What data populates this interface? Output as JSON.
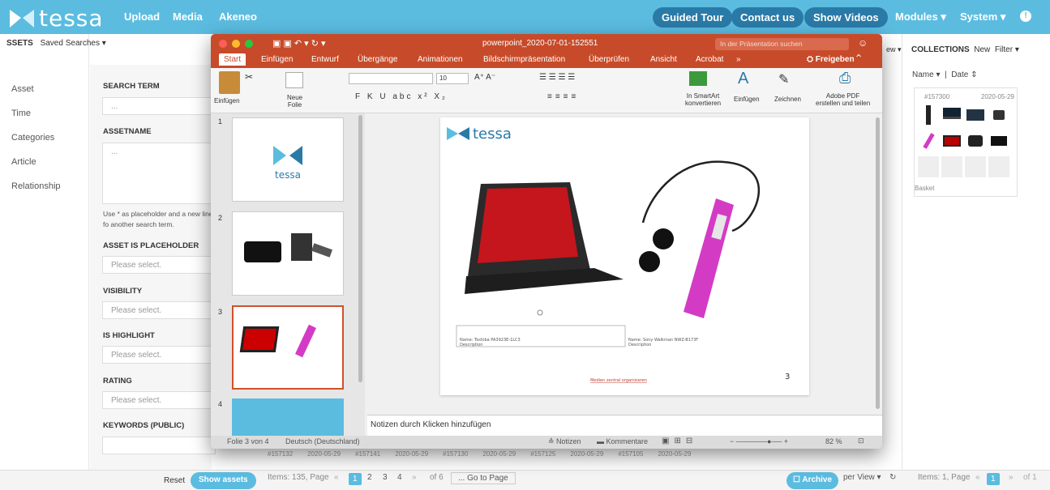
{
  "app": {
    "logo": "tessa"
  },
  "topnav": {
    "upload": "Upload",
    "media": "Media",
    "akeneo": "Akeneo"
  },
  "topright": {
    "guided_tour": "Guided Tour",
    "contact": "Contact us",
    "videos": "Show Videos",
    "modules": "Modules ▾",
    "system": "System ▾",
    "info": "!"
  },
  "assets_bar": {
    "assets": "SSETS",
    "saved_searches": "Saved Searches ▾"
  },
  "left_nav": [
    "Asset",
    "Time",
    "Categories",
    "Article",
    "Relationship"
  ],
  "form": {
    "search_term": "SEARCH TERM",
    "search_placeholder": "...",
    "assetname": "ASSETNAME",
    "assetname_placeholder": "...",
    "hint": "Use * as placeholder and a new line fo another search term.",
    "placeholder_label": "ASSET IS PLACEHOLDER",
    "visibility": "VISIBILITY",
    "highlight": "IS HIGHLIGHT",
    "rating": "RATING",
    "keywords": "KEYWORDS (PUBLIC)",
    "select": "Please select."
  },
  "bottom": {
    "reset": "Reset",
    "show": "Show assets",
    "items": "Items: 135, Page",
    "pages": [
      "1",
      "2",
      "3",
      "4"
    ],
    "of": "of 6",
    "goto": "... Go to Page",
    "archive": "Archive",
    "perview": "per View ▾",
    "right_items": "Items: 1, Page",
    "right_page": "1",
    "right_of": "of 1"
  },
  "collections": {
    "title": "COLLECTIONS",
    "new": "New",
    "filter": "Filter ▾",
    "name": "Name ▾",
    "date": "Date ⇕",
    "id": "#157300",
    "cdate": "2020-05-29",
    "basket": "Basket",
    "view": "ew ▾"
  },
  "ppt": {
    "filename": "powerpoint_2020-07-01-152551",
    "search": "In der Präsentation suchen",
    "tabs": [
      "Start",
      "Einfügen",
      "Entwurf",
      "Übergänge",
      "Animationen",
      "Bildschirmpräsentation",
      "Überprüfen",
      "Ansicht",
      "Acrobat",
      "»"
    ],
    "share": "Freigeben",
    "ribbon": {
      "einfuegen": "Einfügen",
      "neue_folie": "Neue\nFolie",
      "font_size": "10",
      "smartart": "In SmartArt\nkonvertieren",
      "einfuegen2": "Einfügen",
      "zeichnen": "Zeichnen",
      "adobe": "Adobe PDF\nerstellen und teilen"
    },
    "slide_nums": [
      "1",
      "2",
      "3",
      "4"
    ],
    "notes": "Notizen durch Klicken hinzufügen",
    "status_slide": "Folie 3 von 4",
    "status_lang": "Deutsch (Deutschland)",
    "status_notes": "Notizen",
    "status_comments": "Kommentare",
    "zoom": "82 %",
    "slide_page": "3",
    "caption_left": "Name: Toshiba PA3923E-1LC3\nDescription",
    "caption_right": "Name: Sony Walkman NWZ-B173F\nDescription",
    "footer_link": "Medien zentral organisieren"
  },
  "bg_grid": [
    "#157132",
    "2020-05-29",
    "#157141",
    "2020-05-29",
    "#157130",
    "2020-05-29",
    "#157125",
    "2020-05-29",
    "#157105",
    "2020-05-29"
  ]
}
